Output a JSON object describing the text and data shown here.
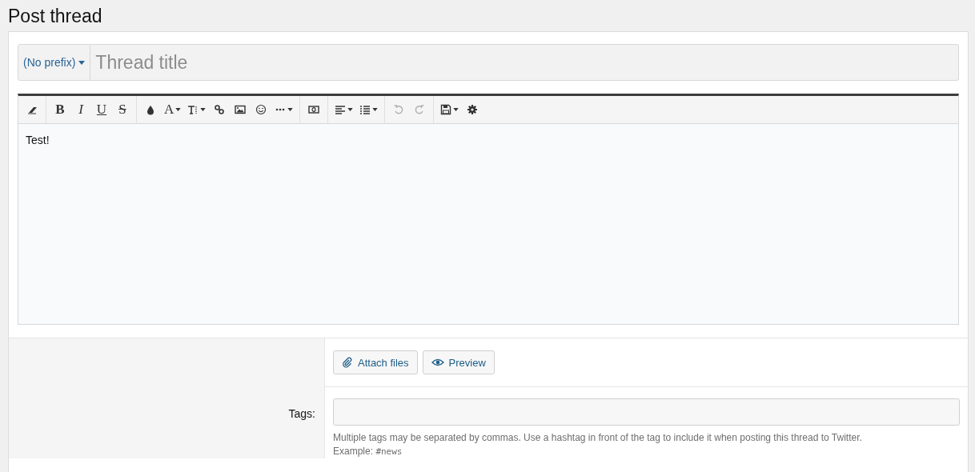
{
  "page_title": "Post thread",
  "title_field": {
    "prefix": "(No prefix)",
    "placeholder": "Thread title"
  },
  "toolbar": [
    [
      {
        "kind": "eraser",
        "dropdown": false,
        "disabled": false
      }
    ],
    [
      {
        "kind": "bold",
        "glyph": "B",
        "dropdown": false,
        "disabled": false
      },
      {
        "kind": "italic",
        "glyph": "I",
        "dropdown": false,
        "disabled": false
      },
      {
        "kind": "underline",
        "glyph": "U",
        "dropdown": false,
        "disabled": false
      },
      {
        "kind": "strike",
        "glyph": "S",
        "dropdown": false,
        "disabled": false
      }
    ],
    [
      {
        "kind": "color",
        "dropdown": false,
        "disabled": false
      },
      {
        "kind": "font-size",
        "glyph": "A",
        "dropdown": true,
        "disabled": false
      },
      {
        "kind": "font-family",
        "dropdown": true,
        "disabled": false
      },
      {
        "kind": "link",
        "dropdown": false,
        "disabled": false
      },
      {
        "kind": "image",
        "dropdown": false,
        "disabled": false
      },
      {
        "kind": "smiley",
        "dropdown": false,
        "disabled": false
      },
      {
        "kind": "more",
        "dropdown": true,
        "disabled": false
      }
    ],
    [
      {
        "kind": "media",
        "dropdown": false,
        "disabled": false
      }
    ],
    [
      {
        "kind": "align",
        "dropdown": true,
        "disabled": false
      },
      {
        "kind": "list",
        "dropdown": true,
        "disabled": false
      }
    ],
    [
      {
        "kind": "undo",
        "dropdown": false,
        "disabled": true
      },
      {
        "kind": "redo",
        "dropdown": false,
        "disabled": true
      }
    ],
    [
      {
        "kind": "save",
        "dropdown": true,
        "disabled": false
      },
      {
        "kind": "settings",
        "dropdown": false,
        "disabled": false
      }
    ]
  ],
  "editor_text": "Test!",
  "buttons": [
    {
      "kind": "attach",
      "label": "Attach files"
    },
    {
      "kind": "preview",
      "label": "Preview"
    }
  ],
  "tags": {
    "label": "Tags:",
    "hint": "Multiple tags may be separated by commas. Use a hashtag in front of the tag to include it when posting this thread to Twitter.",
    "example_label": "Example:",
    "example": "#news"
  }
}
